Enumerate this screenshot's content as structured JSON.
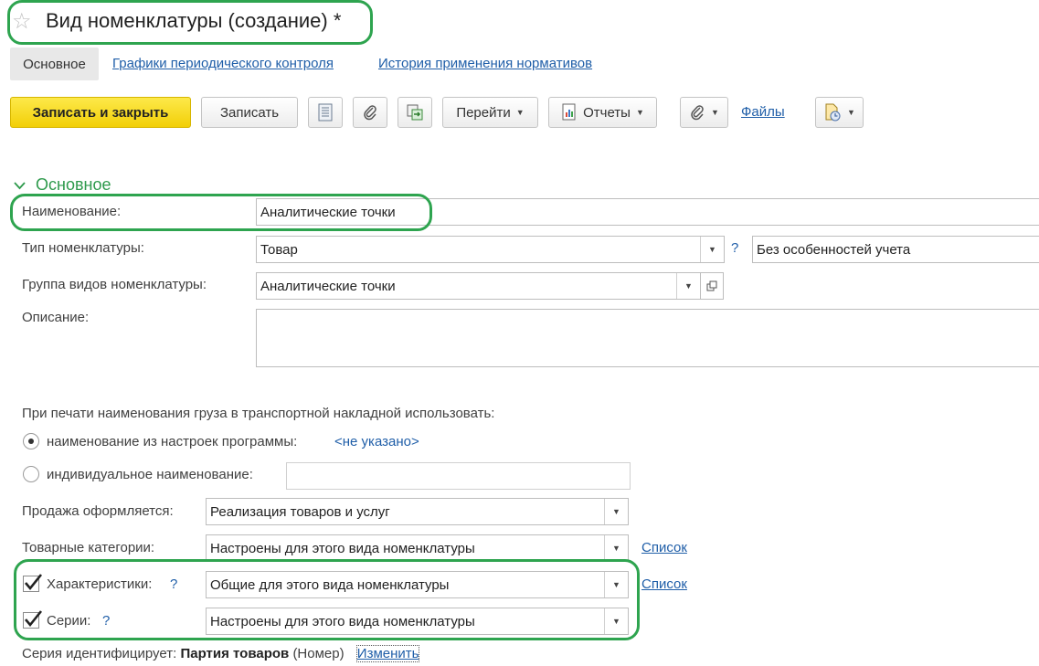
{
  "window": {
    "title": "Вид номенклатуры (создание) *",
    "favorite_icon": "star-icon"
  },
  "tabs": [
    {
      "label": "Основное",
      "active": true
    },
    {
      "label": "Графики периодического контроля",
      "active": false
    },
    {
      "label": "История применения нормативов",
      "active": false
    }
  ],
  "toolbar": {
    "save_close": "Записать и закрыть",
    "save": "Записать",
    "goto": "Перейти",
    "reports": "Отчеты",
    "files": "Файлы"
  },
  "section": {
    "title": "Основное"
  },
  "form": {
    "name_label": "Наименование:",
    "name_value": "Аналитические точки",
    "type_label": "Тип номенклатуры:",
    "type_value": "Товар",
    "type_help": "?",
    "accounting_value": "Без особенностей учета",
    "group_label": "Группа видов номенклатуры:",
    "group_value": "Аналитические точки",
    "description_label": "Описание:",
    "description_value": "",
    "print_caption": "При печати наименования груза в транспортной накладной использовать:",
    "radio_settings_label": "наименование из настроек программы:",
    "radio_settings_value": "<не указано>",
    "radio_individual_label": "индивидуальное наименование:",
    "individual_value": "",
    "sale_label": "Продажа оформляется:",
    "sale_value": "Реализация товаров и услуг",
    "categories_label": "Товарные категории:",
    "categories_value": "Настроены для этого вида номенклатуры",
    "categories_link": "Список",
    "characteristics_label": "Характеристики:",
    "characteristics_help": "?",
    "characteristics_value": "Общие для этого вида номенклатуры",
    "characteristics_link": "Список",
    "series_label": "Серии:",
    "series_help": "?",
    "series_value": "Настроены для этого вида номенклатуры",
    "series_identifies_label": "Серия идентифицирует:",
    "series_identifies_value": "Партия товаров",
    "series_identifies_extra": "(Номер)",
    "series_change_link": "Изменить"
  },
  "colors": {
    "highlight": "#2ea44f",
    "primary_button": "#f5d50f",
    "link": "#1f5ea8",
    "section_title": "#2e9a4c"
  }
}
